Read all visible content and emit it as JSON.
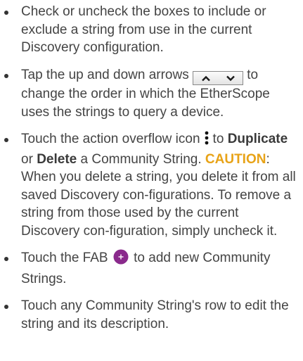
{
  "items": [
    {
      "text": "Check or uncheck the boxes to include or exclude a string from use in the current Discovery configuration."
    },
    {
      "before": "Tap the up and down arrows",
      "after": "to change the order in which the EtherScope uses the strings to query a device.",
      "icon": "up-down-arrow-buttons-icon"
    },
    {
      "before": "Touch the action overflow icon",
      "after_a": "to",
      "duplicate": "Duplicate",
      "or": "or",
      "delete": "Delete",
      "after_b": "a Community String.",
      "caution_label": "CAUTION",
      "caution_text": ": When you delete a string, you delete it from all saved Discovery con-figurations. To remove a string from those used by the current Discovery con-figuration, simply uncheck it.",
      "icon": "action-overflow-icon"
    },
    {
      "before": "Touch the FAB",
      "after": "to add new Community Strings.",
      "icon": "fab-plus-icon"
    },
    {
      "text": "Touch any Community String's row to edit the string and its description."
    }
  ],
  "colors": {
    "text": "#444444",
    "caution": "#e8a317",
    "fab": "#8a2a8c"
  }
}
